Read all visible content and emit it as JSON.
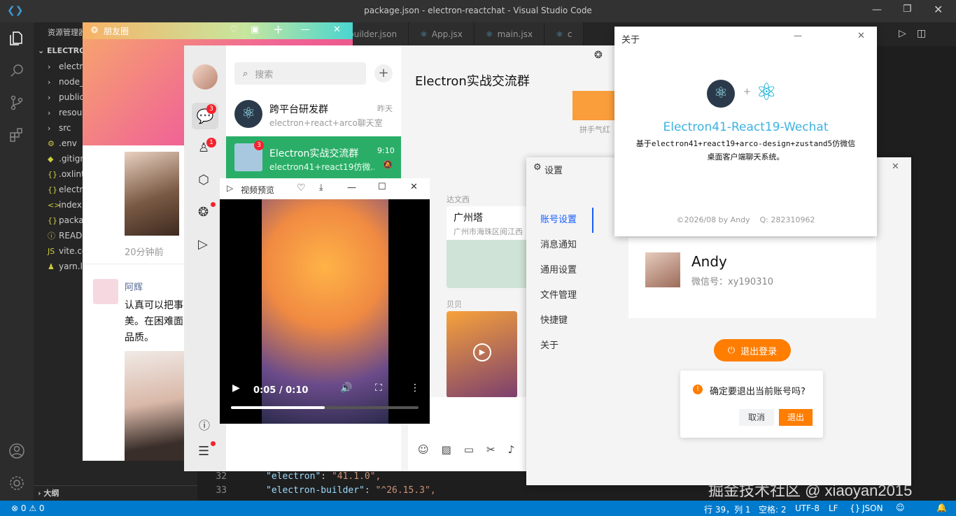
{
  "vscode": {
    "title": "package.json - electron-reactchat - Visual Studio Code",
    "explorer_title": "资源管理器",
    "project": "ELECTRON",
    "tree": [
      "electro",
      "node_",
      "public",
      "resour",
      "src",
      ".env",
      ".gitign",
      ".oxlint",
      "electro",
      "index.h",
      "packag",
      "READM",
      "vite.co",
      "yarn.lo"
    ],
    "outline": "大纲",
    "tabs": [
      "builder.json",
      "App.jsx",
      "main.jsx",
      "c"
    ],
    "code_lines": [
      {
        "num": "32",
        "key": "\"electron\"",
        "val": "\"41.1.0\","
      },
      {
        "num": "33",
        "key": "\"electron-builder\"",
        "val": "\"^26.15.3\","
      }
    ],
    "status": {
      "errors": "0",
      "warnings": "0",
      "pos": "行 39，列 1",
      "spaces": "空格: 2",
      "enc": "UTF-8",
      "eol": "LF",
      "lang": "JSON"
    },
    "watermark": "掘金技术社区 @ xiaoyan2015"
  },
  "moments": {
    "title": "朋友圈",
    "time_ago": "20分钟前",
    "user": "阿辉",
    "text": "认真可以把事\n美。在困难面\n品质。"
  },
  "wechat": {
    "nav_badges": {
      "chat": "3",
      "contacts": "1"
    },
    "search_placeholder": "搜索",
    "chats": [
      {
        "name": "跨平台研发群",
        "preview": "electron+react+arco聊天室",
        "time": "昨天"
      },
      {
        "name": "Electron实战交流群",
        "preview": "electron41+react19仿微...",
        "time": "9:10",
        "badge": "3"
      }
    ],
    "chat_title": "Electron实战交流群",
    "msg1_user": "达文西",
    "location_title": "广州塔",
    "location_addr": "广州市海珠区阅江西",
    "msg2_user": "贝贝",
    "redpacket_hint": "拼手气红"
  },
  "video": {
    "title": "视频预览",
    "time": "0:05 / 0:10",
    "progress": 0.5
  },
  "about": {
    "title": "关于",
    "app_name": "Electron41-React19-Wechat",
    "desc_line1": "基于electron41+react19+arco-design+zustand5仿微信",
    "desc_line2": "桌面客户端聊天系统。",
    "copyright": "©2026/08 by Andy    Q: 282310962",
    "plus": "+"
  },
  "settings": {
    "title": "设置",
    "menu": [
      "账号设置",
      "消息通知",
      "通用设置",
      "文件管理",
      "快捷键",
      "关于"
    ],
    "active": "账号设置",
    "profile_name": "Andy",
    "wechat_id": "微信号：xy190310",
    "logout": "退出登录",
    "confirm_text": "确定要退出当前账号吗?",
    "cancel": "取消",
    "ok": "退出"
  },
  "colors": {
    "wechat_green": "#07c160",
    "selected": "#2aae67",
    "accent": "#ff7d00",
    "vs_blue": "#007acc",
    "link_blue": "#165dff"
  }
}
